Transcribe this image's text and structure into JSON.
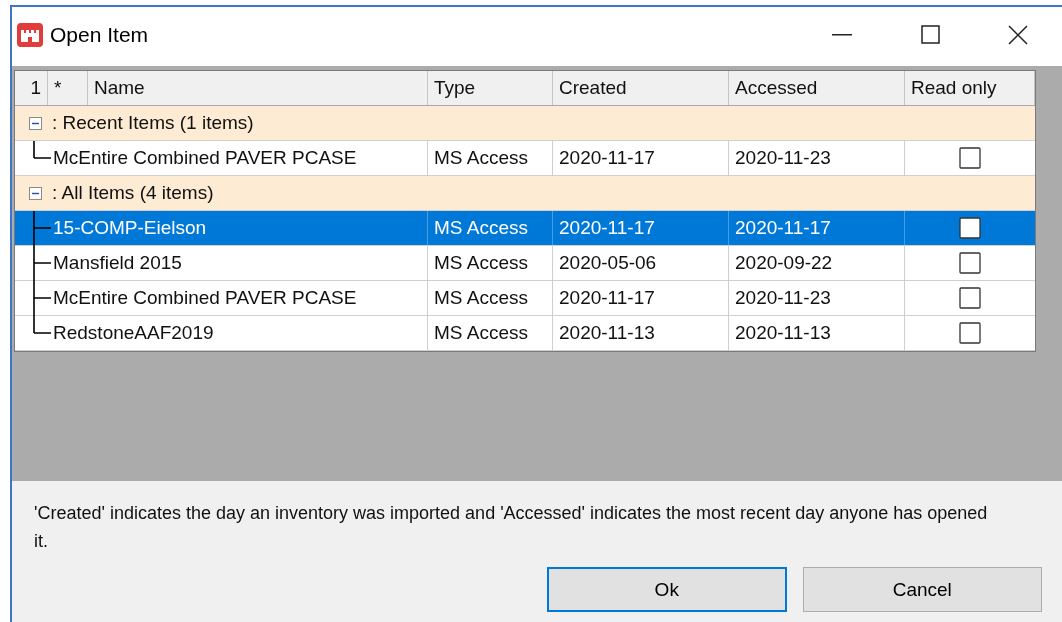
{
  "window": {
    "title": "Open Item"
  },
  "table": {
    "columns": [
      "1",
      "*",
      "Name",
      "Type",
      "Created",
      "Accessed",
      "Read only"
    ],
    "groups": [
      {
        "label": ": Recent Items (1 items)",
        "expanded": true,
        "children": [
          {
            "name": "McEntire Combined PAVER PCASE",
            "type": "MS Access",
            "created": "2020-11-17",
            "accessed": "2020-11-23",
            "read_only": false,
            "selected": false
          }
        ]
      },
      {
        "label": ": All Items (4 items)",
        "expanded": true,
        "children": [
          {
            "name": "15-COMP-Eielson",
            "type": "MS Access",
            "created": "2020-11-17",
            "accessed": "2020-11-17",
            "read_only": false,
            "selected": true
          },
          {
            "name": "Mansfield 2015",
            "type": "MS Access",
            "created": "2020-05-06",
            "accessed": "2020-09-22",
            "read_only": false,
            "selected": false
          },
          {
            "name": "McEntire Combined PAVER PCASE",
            "type": "MS Access",
            "created": "2020-11-17",
            "accessed": "2020-11-23",
            "read_only": false,
            "selected": false
          },
          {
            "name": "RedstoneAAF2019",
            "type": "MS Access",
            "created": "2020-11-13",
            "accessed": "2020-11-13",
            "read_only": false,
            "selected": false
          }
        ]
      }
    ]
  },
  "footer": {
    "note": "'Created' indicates the day an inventory was imported and 'Accessed' indicates the most recent day anyone has opened it."
  },
  "buttons": [
    {
      "label": "Ok",
      "default": true
    },
    {
      "label": "Cancel",
      "default": false
    }
  ]
}
